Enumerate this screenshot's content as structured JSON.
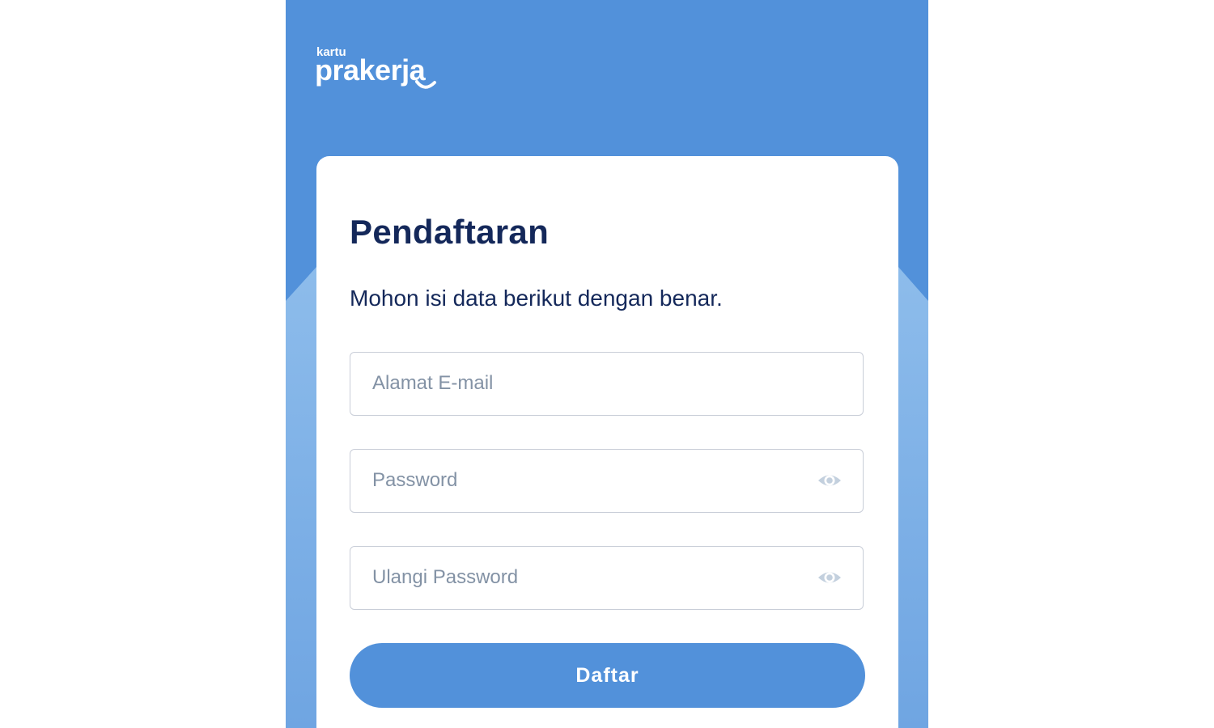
{
  "brand": {
    "small": "kartu",
    "name": "prakerja",
    "primary_color": "#5291da",
    "text_color": "#14285a"
  },
  "form": {
    "title": "Pendaftaran",
    "subtitle": "Mohon isi data berikut dengan benar.",
    "email": {
      "value": "",
      "placeholder": "Alamat E-mail"
    },
    "password": {
      "value": "",
      "placeholder": "Password",
      "icon": "eye-icon"
    },
    "confirm_password": {
      "value": "",
      "placeholder": "Ulangi Password",
      "icon": "eye-icon"
    },
    "submit_label": "Daftar"
  }
}
